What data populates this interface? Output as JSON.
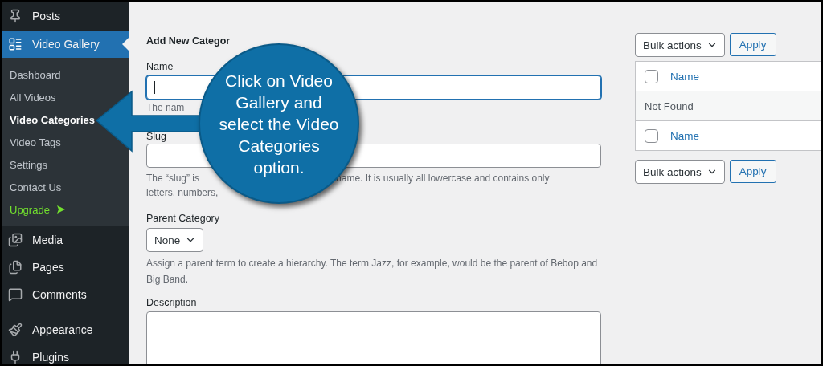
{
  "sidebar": {
    "menu_top": [
      {
        "label": "Posts",
        "selected": false
      },
      {
        "label": "Video Gallery",
        "selected": true
      }
    ],
    "submenu": [
      {
        "label": "Dashboard",
        "selected": false,
        "kind": "link"
      },
      {
        "label": "All Videos",
        "selected": false,
        "kind": "link"
      },
      {
        "label": "Video Categories",
        "selected": true,
        "kind": "link"
      },
      {
        "label": "Video Tags",
        "selected": false,
        "kind": "link"
      },
      {
        "label": "Settings",
        "selected": false,
        "kind": "link"
      },
      {
        "label": "Contact Us",
        "selected": false,
        "kind": "link"
      },
      {
        "label": "Upgrade",
        "selected": false,
        "kind": "upgrade"
      }
    ],
    "menu_bottom": [
      {
        "label": "Media",
        "selected": false
      },
      {
        "label": "Pages",
        "selected": false
      },
      {
        "label": "Comments",
        "selected": false
      },
      {
        "label": "Appearance",
        "selected": false
      },
      {
        "label": "Plugins",
        "selected": false
      }
    ]
  },
  "form": {
    "heading": "Add New Categor",
    "name_label": "Name",
    "name_hint": "The nam",
    "slug_label": "Slug",
    "slug_hint_parts": [
      "The “slug” is",
      "name. It is usually all lowercase and contains only"
    ],
    "slug_hint_line2": "letters, numbers,",
    "parent_label": "Parent Category",
    "parent_value": "None",
    "parent_hint": "Assign a parent term to create a hierarchy. The term Jazz, for example, would be the parent of Bebop and Big Band.",
    "description_label": "Description"
  },
  "table": {
    "bulk_top": "Bulk actions",
    "apply_top": "Apply",
    "header": {
      "label": "Name",
      "checked": false
    },
    "empty": "Not Found",
    "footer": {
      "label": "Name",
      "checked": false
    },
    "bulk_bottom": "Bulk actions",
    "apply_bottom": "Apply"
  },
  "callout": {
    "text": "Click on Video Gallery and select the Video Categories option."
  }
}
